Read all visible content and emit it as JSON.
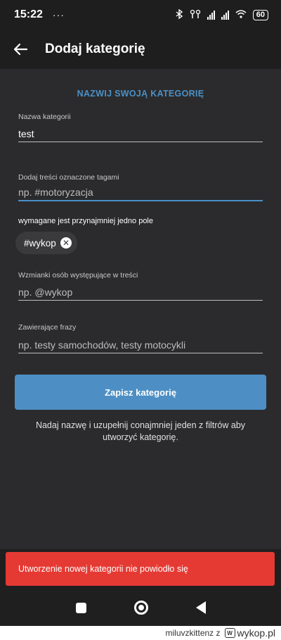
{
  "status_bar": {
    "time": "15:22",
    "dots": "···",
    "battery": "60"
  },
  "app_bar": {
    "title": "Dodaj kategorię"
  },
  "form": {
    "section_title": "NAZWIJ SWOJĄ KATEGORIĘ",
    "name_label": "Nazwa kategorii",
    "name_value": "test",
    "tags_label": "Dodaj treści oznaczone tagami",
    "tags_placeholder": "np. #motoryzacja",
    "required_note": "wymagane jest przynajmniej jedno pole",
    "chips": [
      {
        "label": "#wykop"
      }
    ],
    "mentions_label": "Wzmianki osób występujące w treści",
    "mentions_placeholder": "np. @wykop",
    "phrases_label": "Zawierające frazy",
    "phrases_placeholder": "np. testy samochodów, testy motocykli",
    "save_button": "Zapisz kategorię",
    "hint": "Nadaj nazwę i uzupełnij conajmniej jeden z filtrów aby utworzyć kategorię."
  },
  "snackbar": {
    "message": "Utworzenie nowej kategorii nie powiodło się"
  },
  "watermark": {
    "text": "miluvzkittenz z",
    "logo_text": "wykop.pl"
  },
  "colors": {
    "accent": "#4b90c6",
    "error": "#e53a33",
    "background": "#2b2b2d"
  }
}
